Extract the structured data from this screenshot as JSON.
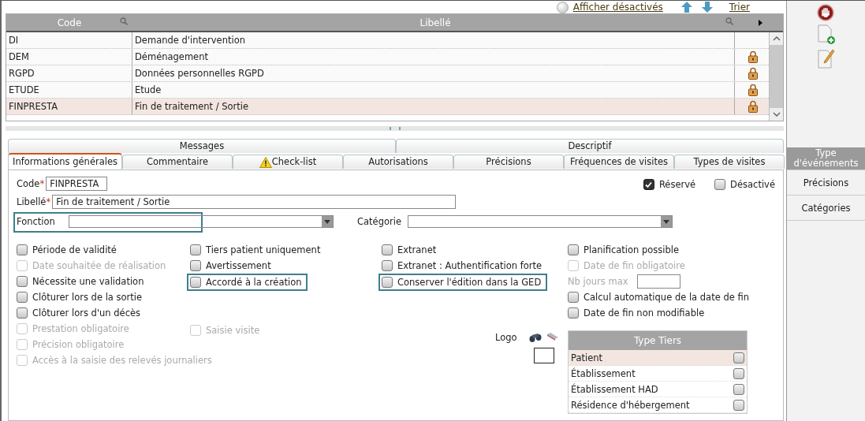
{
  "toolbar": {
    "show_disabled": "Afficher désactivés",
    "sort": "Trier"
  },
  "table": {
    "columns": [
      "Code",
      "Libellé"
    ],
    "rows": [
      {
        "code": "DI",
        "label": "Demande d'intervention",
        "locked": false,
        "selected": false
      },
      {
        "code": "DEM",
        "label": "Déménagement",
        "locked": true,
        "selected": false
      },
      {
        "code": "RGPD",
        "label": "Données personnelles RGPD",
        "locked": true,
        "selected": false
      },
      {
        "code": "ETUDE",
        "label": "Etude",
        "locked": true,
        "selected": false
      },
      {
        "code": "FINPRESTA",
        "label": "Fin de traitement / Sortie",
        "locked": true,
        "selected": true
      }
    ]
  },
  "tabs_top": [
    {
      "label": "Messages",
      "selected": false
    },
    {
      "label": "Descriptif",
      "selected": false
    }
  ],
  "tabs": [
    {
      "label": "Informations générales",
      "selected": true,
      "warning": false
    },
    {
      "label": "Commentaire",
      "selected": false,
      "warning": false
    },
    {
      "label": "Check-list",
      "selected": false,
      "warning": true
    },
    {
      "label": "Autorisations",
      "selected": false,
      "warning": false
    },
    {
      "label": "Précisions",
      "selected": false,
      "warning": false
    },
    {
      "label": "Fréquences de visites",
      "selected": false,
      "warning": false
    },
    {
      "label": "Types de visites",
      "selected": false,
      "warning": false
    }
  ],
  "form": {
    "code": {
      "label": "Code",
      "required_mark": "*",
      "value": "FINPRESTA"
    },
    "libelle": {
      "label": "Libellé",
      "required_mark": "*",
      "value": "Fin de traitement / Sortie"
    },
    "flags": [
      {
        "label": "Réservé",
        "checked": true
      },
      {
        "label": "Désactivé",
        "checked": false
      }
    ],
    "fonction": {
      "label": "Fonction",
      "highlighted": true
    },
    "categorie": {
      "label": "Catégorie"
    },
    "columns": [
      [
        {
          "label": "Période de validité",
          "checked": false,
          "disabled": false,
          "highlighted": false
        },
        {
          "label": "Date souhaitée de réalisation",
          "checked": false,
          "disabled": true,
          "highlighted": false
        },
        {
          "label": "Nécessite une validation",
          "checked": false,
          "disabled": false,
          "highlighted": false
        },
        {
          "label": "Clôturer lors de la sortie",
          "checked": false,
          "disabled": false,
          "highlighted": false
        },
        {
          "label": "Clôturer lors d'un décès",
          "checked": false,
          "disabled": false,
          "highlighted": false
        },
        {
          "label": "Prestation obligatoire",
          "checked": false,
          "disabled": true,
          "highlighted": false
        },
        {
          "label": "Précision obligatoire",
          "checked": false,
          "disabled": true,
          "highlighted": false
        },
        {
          "label": "Accès à la saisie des relevés journaliers",
          "checked": false,
          "disabled": true,
          "highlighted": false
        }
      ],
      [
        {
          "label": "Tiers patient uniquement",
          "checked": false,
          "disabled": false,
          "highlighted": false
        },
        {
          "label": "Avertissement",
          "checked": false,
          "disabled": false,
          "highlighted": false
        },
        {
          "label": "Accordé à la création",
          "checked": false,
          "disabled": false,
          "highlighted": true
        },
        {
          "label": "Saisie visite",
          "checked": false,
          "disabled": true,
          "highlighted": false
        }
      ],
      [
        {
          "label": "Extranet",
          "checked": false,
          "disabled": false,
          "highlighted": false
        },
        {
          "label": "Extranet : Authentification forte",
          "checked": false,
          "disabled": false,
          "highlighted": false
        },
        {
          "label": "Conserver l'édition dans la GED",
          "checked": false,
          "disabled": false,
          "highlighted": true
        }
      ]
    ],
    "col4": {
      "planif": {
        "label": "Planification possible",
        "checked": false,
        "disabled": false
      },
      "date_fin": {
        "label": "Date de fin obligatoire",
        "checked": false,
        "disabled": true
      },
      "nb_jours": "Nb jours max",
      "after": [
        {
          "label": "Calcul automatique de la date de fin",
          "checked": false,
          "disabled": false
        },
        {
          "label": "Date de fin non modifiable",
          "checked": false,
          "disabled": false
        }
      ]
    },
    "logo": "Logo",
    "type_tiers": {
      "title": "Type Tiers",
      "items": [
        {
          "label": "Patient",
          "checked": false,
          "selected": true
        },
        {
          "label": "Établissement",
          "checked": false,
          "selected": false
        },
        {
          "label": "Établissement HAD",
          "checked": false,
          "selected": false
        },
        {
          "label": "Résidence d'hébergement",
          "checked": false,
          "selected": false
        }
      ]
    }
  },
  "sidebar": {
    "items": [
      {
        "label": "Type d'événements",
        "selected": true
      },
      {
        "label": "Précisions",
        "selected": false
      },
      {
        "label": "Catégories",
        "selected": false
      }
    ]
  }
}
